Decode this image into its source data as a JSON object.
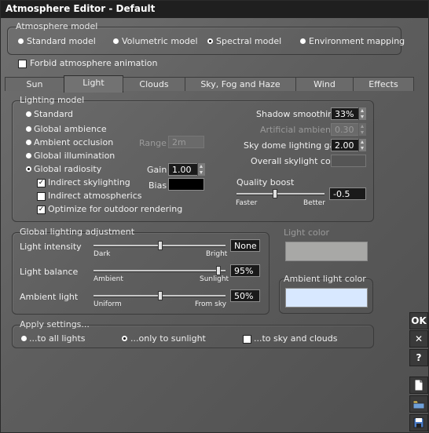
{
  "window": {
    "title": "Atmosphere Editor - Default"
  },
  "atmosphere_model": {
    "label": "Atmosphere model",
    "options": [
      "Standard model",
      "Volumetric model",
      "Spectral model",
      "Environment mapping"
    ],
    "selected": "Spectral model"
  },
  "forbid_animation": {
    "label": "Forbid atmosphere animation",
    "checked": false
  },
  "tabs": [
    "Sun",
    "Light",
    "Clouds",
    "Sky, Fog and Haze",
    "Wind",
    "Effects"
  ],
  "active_tab": "Light",
  "lighting_model": {
    "label": "Lighting model",
    "options": [
      "Standard",
      "Global ambience",
      "Ambient occlusion",
      "Global illumination",
      "Global radiosity"
    ],
    "selected": "Global radiosity",
    "range_label": "Range",
    "range_value": "2m",
    "gain_label": "Gain",
    "gain_value": "1.00",
    "bias_label": "Bias",
    "indirect_skylighting": {
      "label": "Indirect skylighting",
      "checked": true
    },
    "indirect_atmospherics": {
      "label": "Indirect atmospherics",
      "checked": false
    },
    "optimize_outdoor": {
      "label": "Optimize for outdoor rendering",
      "checked": true
    },
    "shadow_smoothing_label": "Shadow smoothing",
    "shadow_smoothing_value": "33%",
    "artificial_ambience_label": "Artificial ambience",
    "artificial_ambience_value": "0.30",
    "sky_dome_gain_label": "Sky dome lighting gain",
    "sky_dome_gain_value": "2.00",
    "overall_skylight_label": "Overall skylight color",
    "quality_boost_label": "Quality boost",
    "quality_boost_value": "-0.5",
    "faster_label": "Faster",
    "better_label": "Better"
  },
  "global_adjust": {
    "label": "Global lighting adjustment",
    "light_intensity": {
      "label": "Light intensity",
      "min": "Dark",
      "max": "Bright",
      "value": "None",
      "level": 0.5
    },
    "light_balance": {
      "label": "Light balance",
      "min": "Ambient",
      "max": "Sunlight",
      "value": "95%",
      "level": 0.95
    },
    "ambient_light": {
      "label": "Ambient light",
      "min": "Uniform",
      "max": "From sky",
      "value": "50%",
      "level": 0.5
    }
  },
  "light_color": {
    "label": "Light color",
    "color": "#a8a8a6"
  },
  "ambient_light_color": {
    "label": "Ambient light color",
    "color": "#d8e8ff"
  },
  "apply": {
    "label": "Apply settings...",
    "all_lights": "...to all lights",
    "only_sunlight": "...only to sunlight",
    "sky_clouds": "...to sky and clouds"
  },
  "side_buttons": {
    "ok": "OK",
    "close": "✕",
    "help": "?"
  }
}
